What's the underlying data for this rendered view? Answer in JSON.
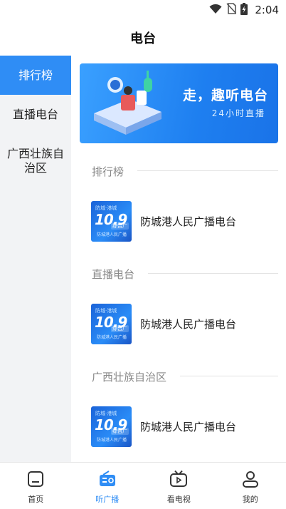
{
  "status": {
    "time": "2:04",
    "icons": [
      "wifi-icon",
      "no-sim-icon",
      "battery-charging-icon"
    ]
  },
  "header": {
    "title": "电台"
  },
  "sidebar": {
    "items": [
      {
        "label": "排行榜",
        "active": true
      },
      {
        "label": "直播电台",
        "active": false
      },
      {
        "label": "广西壮族自治区",
        "active": false
      }
    ]
  },
  "banner": {
    "title": "走，趣听电台",
    "subtitle": "24小时直播"
  },
  "sections": [
    {
      "title": "排行榜",
      "station": {
        "name": "防城港人民广播电台"
      }
    },
    {
      "title": "直播电台",
      "station": {
        "name": "防城港人民广播电台"
      }
    },
    {
      "title": "广西壮族自治区",
      "station": {
        "name": "防城港人民广播电台"
      }
    }
  ],
  "thumb": {
    "top": "防城·港城",
    "main": "10.9",
    "tag": "综合广",
    "bottom": "防城港人民广播"
  },
  "nav": {
    "items": [
      {
        "label": "首页",
        "icon": "home-icon",
        "active": false
      },
      {
        "label": "听广播",
        "icon": "radio-icon",
        "active": true
      },
      {
        "label": "看电视",
        "icon": "tv-icon",
        "active": false
      },
      {
        "label": "我的",
        "icon": "user-icon",
        "active": false
      }
    ]
  },
  "colors": {
    "accent": "#2f8df5",
    "sidebar_bg": "#f2f3f5",
    "muted_text": "#888888"
  }
}
